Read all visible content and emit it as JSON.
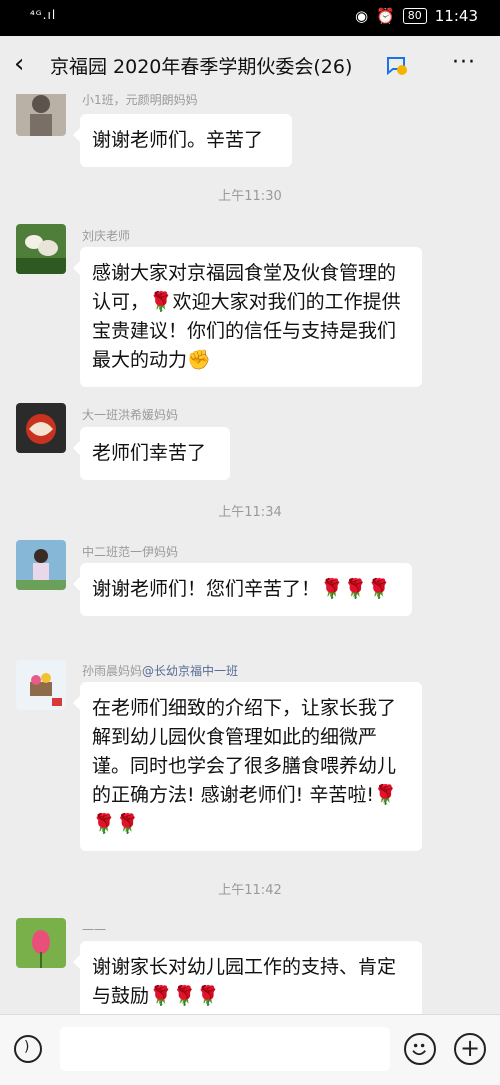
{
  "status_bar": {
    "signal": "⁴ᴳ.ıl",
    "battery": "80",
    "time": "11:43"
  },
  "header": {
    "back_icon": "back-arrow-icon",
    "title": "京福园 2020年春季学期伙委会(26)",
    "more_icon": "more-icon"
  },
  "messages": [
    {
      "sender": "小1班，元颜明朗妈妈",
      "text": "谢谢老师们。辛苦了"
    },
    {
      "timestamp": "上午11:30"
    },
    {
      "sender": "刘庆老师",
      "text": "感谢大家对京福园食堂及伙食管理的认可，🌹欢迎大家对我们的工作提供宝贵建议！你们的信任与支持是我们最大的动力✊"
    },
    {
      "sender": "大一班洪希媛妈妈",
      "text": "老师们幸苦了"
    },
    {
      "timestamp": "上午11:34"
    },
    {
      "sender": "中二班范一伊妈妈",
      "text": "谢谢老师们！您们辛苦了！🌹🌹🌹"
    },
    {
      "sender": "孙雨晨妈妈",
      "mention": "@长幼京福中一班",
      "text": "在老师们细致的介绍下，让家长我了解到幼儿园伙食管理如此的细微严谨。同时也学会了很多膳食喂养幼儿的正确方法! 感谢老师们! 辛苦啦!🌹🌹🌹"
    },
    {
      "timestamp": "上午11:42"
    },
    {
      "sender": "一一",
      "text": "谢谢家长对幼儿园工作的支持、肯定与鼓励🌹🌹🌹"
    }
  ],
  "input_bar": {
    "voice_icon": "voice-icon",
    "emoji_icon": "emoji-icon",
    "plus_icon": "plus-icon",
    "placeholder": ""
  }
}
